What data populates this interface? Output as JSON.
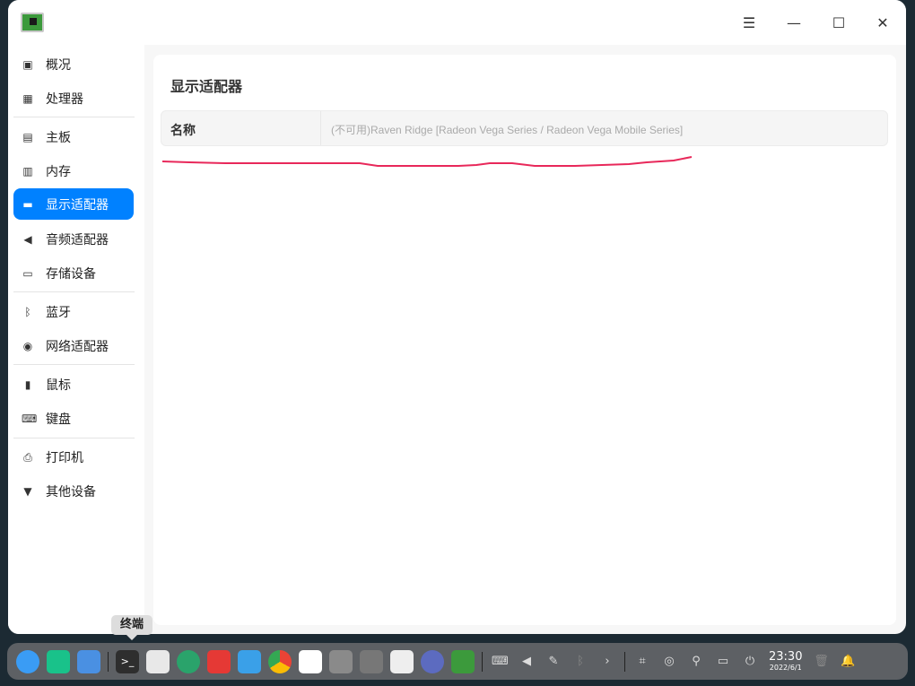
{
  "window": {
    "controls": {
      "menu": "☰",
      "minimize": "—",
      "maximize": "☐",
      "close": "✕"
    }
  },
  "sidebar": {
    "items": [
      {
        "label": "概况",
        "icon": "monitor-icon",
        "glyph": "▣"
      },
      {
        "label": "处理器",
        "icon": "cpu-icon",
        "glyph": "▦"
      },
      {
        "label": "主板",
        "icon": "motherboard-icon",
        "glyph": "▤"
      },
      {
        "label": "内存",
        "icon": "memory-icon",
        "glyph": "▥"
      },
      {
        "label": "显示适配器",
        "icon": "display-adapter-icon",
        "glyph": "▬"
      },
      {
        "label": "音频适配器",
        "icon": "speaker-icon",
        "glyph": "◀"
      },
      {
        "label": "存储设备",
        "icon": "storage-icon",
        "glyph": "▭"
      },
      {
        "label": "蓝牙",
        "icon": "bluetooth-icon",
        "glyph": "ᛒ"
      },
      {
        "label": "网络适配器",
        "icon": "network-icon",
        "glyph": "◉"
      },
      {
        "label": "鼠标",
        "icon": "mouse-icon",
        "glyph": "▮"
      },
      {
        "label": "键盘",
        "icon": "keyboard-icon",
        "glyph": "⌨"
      },
      {
        "label": "打印机",
        "icon": "printer-icon",
        "glyph": "⎙"
      },
      {
        "label": "其他设备",
        "icon": "other-device-icon",
        "glyph": "▼"
      }
    ]
  },
  "main": {
    "title": "显示适配器",
    "rows": [
      {
        "key": "名称",
        "value": "(不可用)Raven Ridge [Radeon Vega Series / Radeon Vega Mobile Series]"
      }
    ]
  },
  "dock": {
    "tooltip": "终端",
    "time": "23:30",
    "date": "2022/6/1",
    "accent": "#0081ff"
  }
}
